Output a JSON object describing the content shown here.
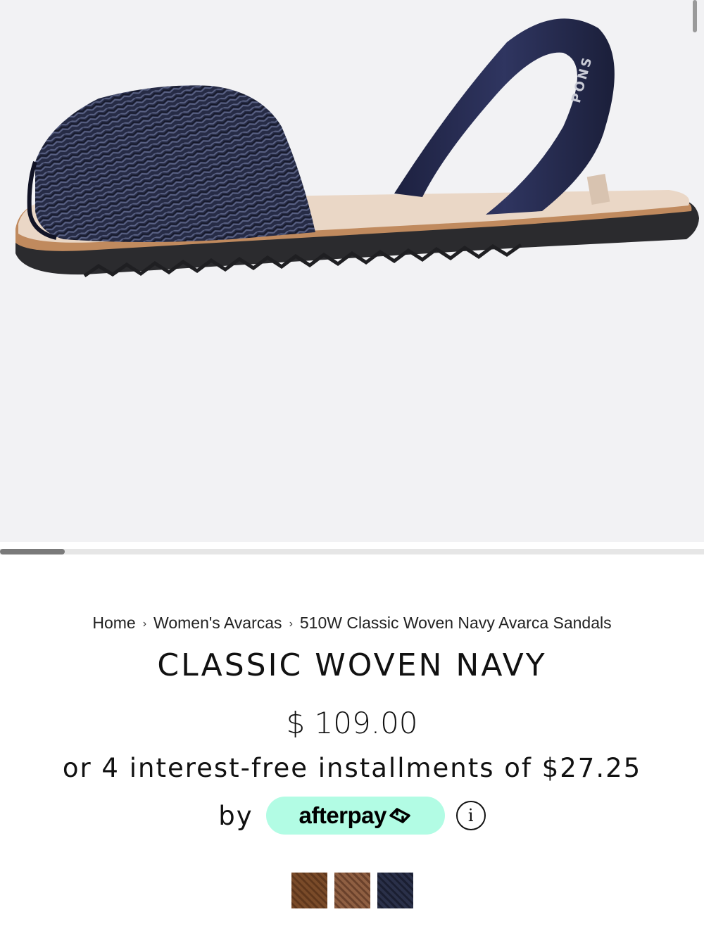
{
  "hero": {
    "image_alt": "Classic Woven Navy avarca sandal, side view",
    "strap_brand_text": "PONS",
    "colors": {
      "background": "#f2f2f4",
      "upper": "#262b45",
      "sole": "#2b2b2e",
      "footbed": "#ead7c6"
    }
  },
  "breadcrumb": {
    "items": [
      "Home",
      "Women's Avarcas",
      "510W Classic Woven Navy Avarca Sandals"
    ],
    "separator": "›"
  },
  "product": {
    "title": "CLASSIC WOVEN NAVY",
    "price": "$ 109.00",
    "installments_text": "or 4 interest-free installments of $27.25",
    "by_text": "by",
    "afterpay_label": "afterpay",
    "info_symbol": "i"
  },
  "swatches": [
    {
      "color_name": "tan",
      "base": "#b08a66",
      "dark": "#8a6546"
    },
    {
      "color_name": "brown",
      "base": "#8f5f42",
      "dark": "#6a412b"
    },
    {
      "color_name": "navy",
      "base": "#2a3049",
      "dark": "#1a1e31",
      "selected": true
    }
  ],
  "colors": {
    "afterpay_mint": "#b2fce4",
    "text": "#111111"
  }
}
